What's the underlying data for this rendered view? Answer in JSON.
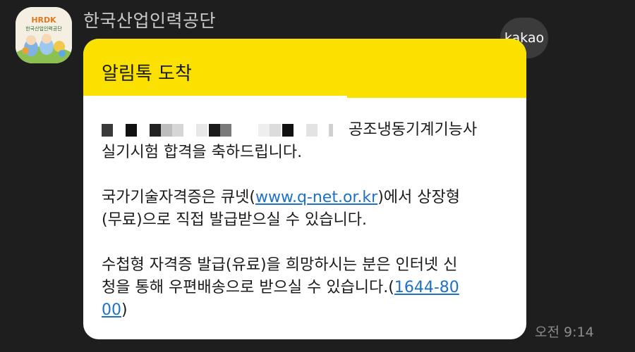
{
  "sender": {
    "name": "한국산업인력공단",
    "avatar_text": "HRDK",
    "avatar_subtext": "한국산업인력공단"
  },
  "badge": {
    "label": "kakao"
  },
  "message": {
    "header_title": "알림톡 도착",
    "line1_suffix": "공조냉동기계기능사",
    "line2": "실기시험 합격을 축하드립니다.",
    "line3_prefix": "국가기술자격증은 큐넷(",
    "line3_link": "www.q-net.or.kr",
    "line3_suffix": ")에서 상장형",
    "line4": "(무료)으로 직접 발급받으실 수 있습니다.",
    "line5": "수첩형 자격증 발급(유료)을 희망하시는 분은 인터넷 신",
    "line6_prefix": "청을 통해 우편배송으로 받으실 수 있습니다.(",
    "line6_link": "1644-80",
    "line7_link": "00",
    "line7_suffix": ")"
  },
  "timestamp": "오전 9:14",
  "colors": {
    "background": "#1e1e1e",
    "bubble_header": "#fae100",
    "bubble_body": "#ffffff",
    "link": "#1d72c8"
  }
}
